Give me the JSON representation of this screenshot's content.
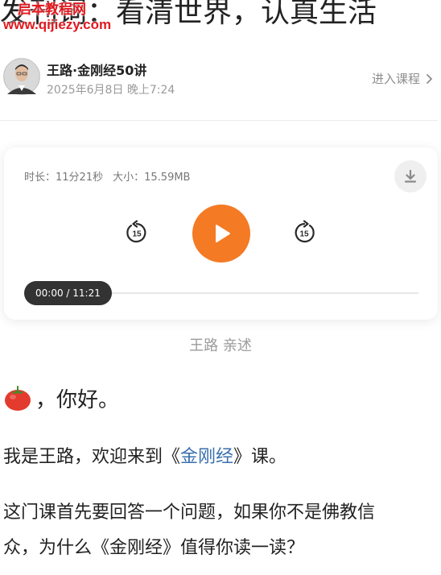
{
  "header": {
    "title": "发刊词：看清世界，认真生活",
    "watermark_cn": "启本教程网",
    "watermark_url": "www.qijiezy.com"
  },
  "author": {
    "name": "王路·金刚经50讲",
    "time": "2025年6月8日 晚上7:24",
    "enter_course": "进入课程"
  },
  "player": {
    "duration_label": "时长：",
    "duration": "11分21秒",
    "size_label": "大小：",
    "size": "15.59MB",
    "skip_seconds": "15",
    "current_time": "00:00",
    "total_time": "11:21",
    "progress_fraction": 0,
    "accent_color": "#f47a24"
  },
  "narrator": "王路 亲述",
  "article": {
    "greeting": "，你好。",
    "p1_before": "我是王路，欢迎来到《",
    "p1_link": "金刚经",
    "p1_after": "》课。",
    "p2_line1": "这门课首先要回答一个问题，如果你不是佛教信",
    "p2_line2": "众，为什么《金刚经》值得你读一读？"
  }
}
